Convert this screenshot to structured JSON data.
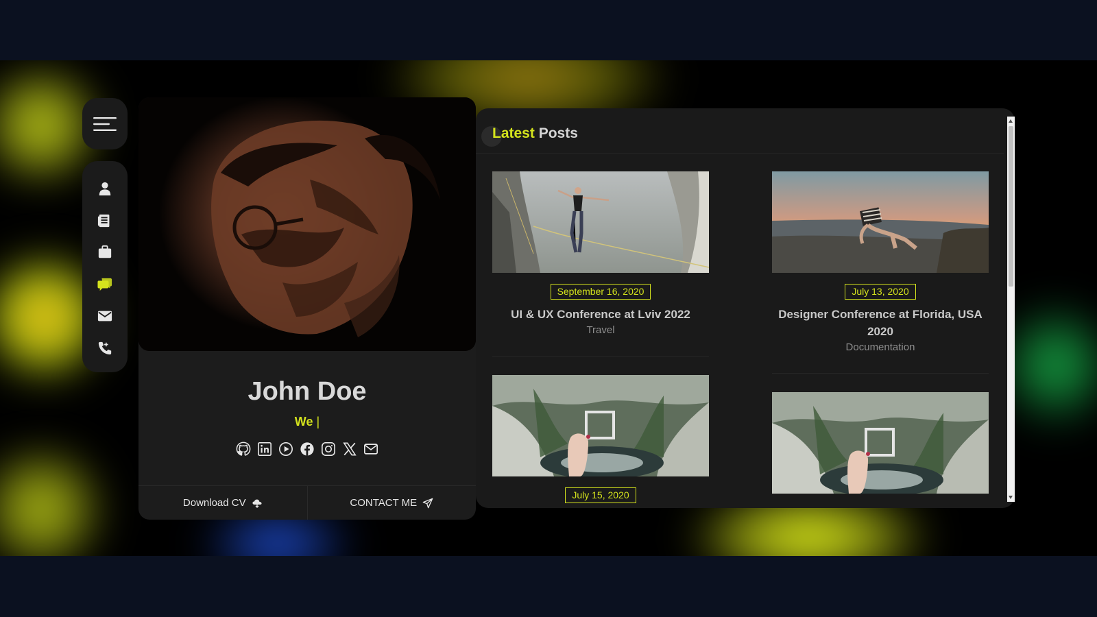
{
  "profile": {
    "name": "John Doe",
    "typed_text": "We",
    "typed_cursor": "|",
    "actions": {
      "download_cv": "Download CV",
      "contact_me": "CONTACT ME"
    },
    "socials": [
      "github-icon",
      "linkedin-icon",
      "play-icon",
      "facebook-icon",
      "instagram-icon",
      "x-icon",
      "mail-icon"
    ]
  },
  "nav": {
    "items": [
      "user-icon",
      "resume-icon",
      "briefcase-icon",
      "chat-icon",
      "envelope-icon",
      "phone-icon"
    ],
    "active": "chat-icon"
  },
  "posts": {
    "title_accent": "Latest",
    "title_rest": "Posts",
    "items": [
      {
        "date": "September 16, 2020",
        "title": "UI & UX Conference at Lviv 2022",
        "category": "Travel"
      },
      {
        "date": "July 13, 2020",
        "title": "Designer Conference at Florida, USA 2020",
        "category": "Documentation"
      },
      {
        "date": "July 15, 2020",
        "title": "",
        "category": ""
      },
      {
        "date": "",
        "title": "",
        "category": ""
      }
    ]
  },
  "colors": {
    "accent": "#d4e31d",
    "panel": "#1a1a1a",
    "page_bg": "#0b1120"
  }
}
